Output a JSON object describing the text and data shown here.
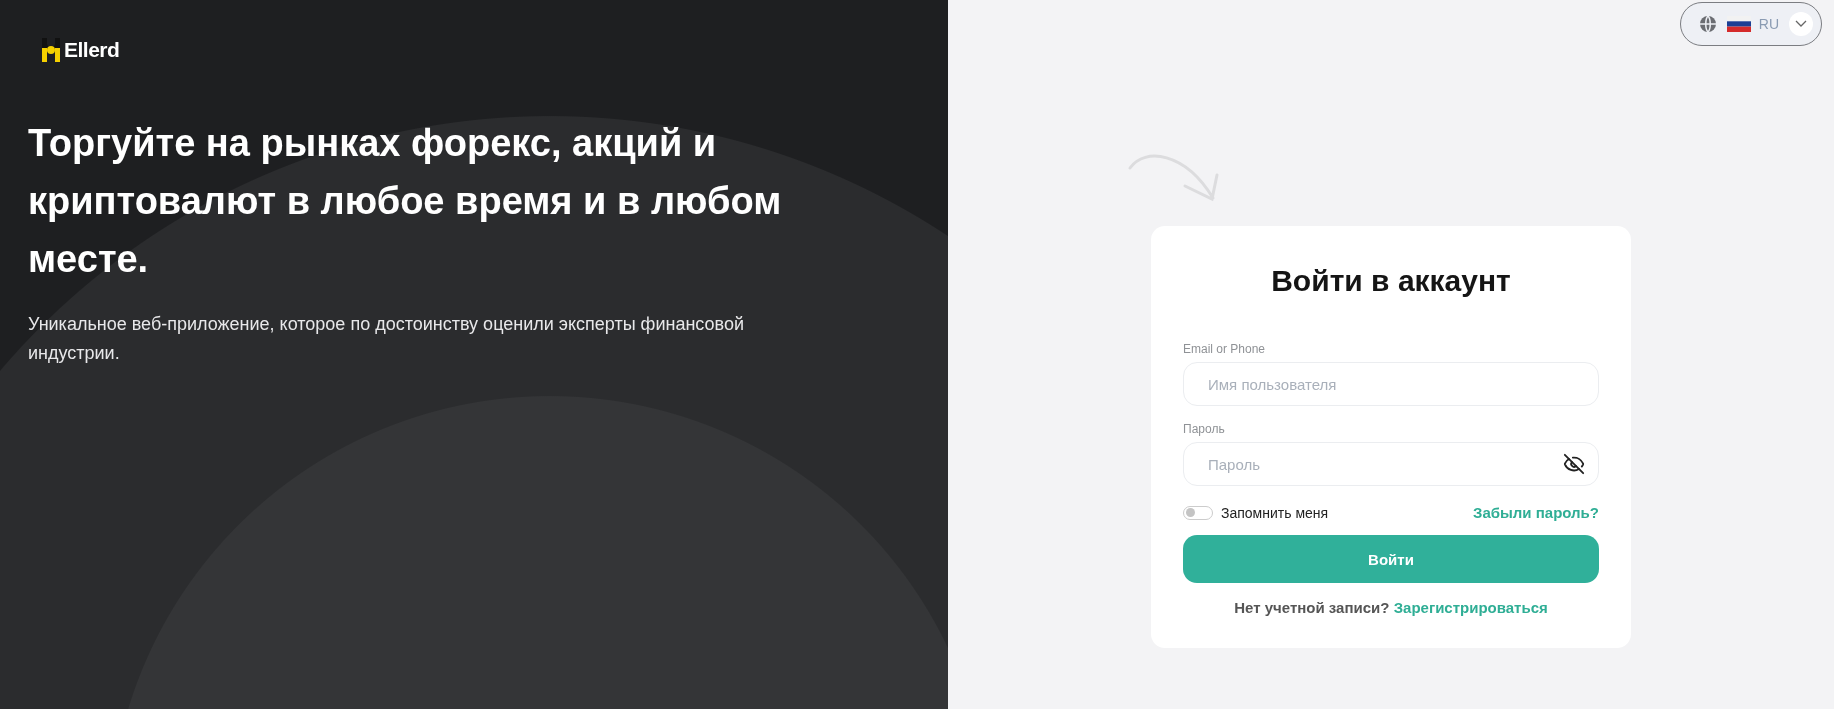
{
  "brand": {
    "name": "Ellerd"
  },
  "hero": {
    "headline": "Торгуйте на рынках форекс, акций и криптовалют в любое время и в любом месте.",
    "subtitle": "Уникальное веб-приложение, которое по достоинству оценили эксперты финансовой индустрии."
  },
  "language": {
    "code": "RU"
  },
  "login": {
    "title": "Войти в аккаунт",
    "fields": [
      {
        "label": "Email or Phone",
        "placeholder": "Имя пользователя",
        "kind": "text"
      },
      {
        "label": "Пароль",
        "placeholder": "Пароль",
        "kind": "password"
      }
    ],
    "remember": {
      "label": "Запомнить меня",
      "on": false
    },
    "forgot_link": "Забыли пароль?",
    "submit": "Войти",
    "signup_prompt": "Нет учетной записи?",
    "signup_link": "Зарегистрироваться"
  }
}
